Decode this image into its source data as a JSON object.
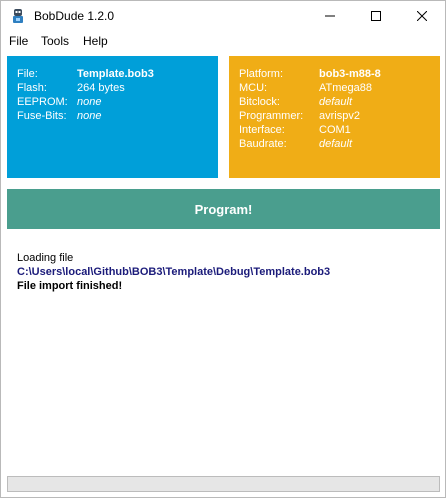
{
  "window": {
    "title": "BobDude 1.2.0"
  },
  "menu": {
    "items": [
      "File",
      "Tools",
      "Help"
    ]
  },
  "file_panel": {
    "rows": [
      {
        "label": "File:",
        "value": "Template.bob3"
      },
      {
        "label": "Flash:",
        "value": "264 bytes"
      },
      {
        "label": "EEPROM:",
        "value": "none"
      },
      {
        "label": "Fuse-Bits:",
        "value": "none"
      }
    ],
    "color": "#009fd9"
  },
  "device_panel": {
    "rows": [
      {
        "label": "Platform:",
        "value": "bob3-m88-8"
      },
      {
        "label": "MCU:",
        "value": "ATmega88"
      },
      {
        "label": "Bitclock:",
        "value": "default"
      },
      {
        "label": "Programmer:",
        "value": "avrispv2"
      },
      {
        "label": "Interface:",
        "value": "COM1"
      },
      {
        "label": "Baudrate:",
        "value": "default"
      }
    ],
    "color": "#f0ad16"
  },
  "program_button": {
    "label": "Program!",
    "color": "#4a9e8e"
  },
  "log": {
    "lines": [
      "Loading file",
      "C:\\Users\\local\\Github\\BOB3\\Template\\Debug\\Template.bob3",
      "File import finished!"
    ]
  },
  "progress": {
    "value": 0
  }
}
